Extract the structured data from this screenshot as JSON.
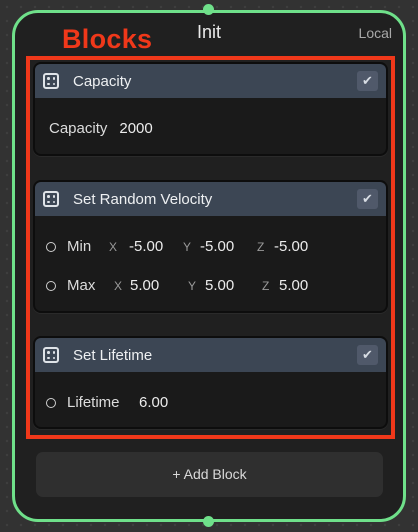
{
  "context": {
    "title": "Init",
    "space": "Local"
  },
  "annotation": {
    "label": "Blocks",
    "color": "#f0381a"
  },
  "accent_color": "#6fe08a",
  "blocks": [
    {
      "title": "Capacity",
      "enabled": true,
      "fields": [
        {
          "label": "Capacity",
          "value": "2000"
        }
      ]
    },
    {
      "title": "Set Random Velocity",
      "enabled": true,
      "fields": [
        {
          "label": "Min",
          "x_axis": "X",
          "x": "-5.00",
          "y_axis": "Y",
          "y": "-5.00",
          "z_axis": "Z",
          "z": "-5.00"
        },
        {
          "label": "Max",
          "x_axis": "X",
          "x": "5.00",
          "y_axis": "Y",
          "y": "5.00",
          "z_axis": "Z",
          "z": "5.00"
        }
      ]
    },
    {
      "title": "Set Lifetime",
      "enabled": true,
      "fields": [
        {
          "label": "Lifetime",
          "value": "6.00"
        }
      ]
    }
  ],
  "add_block_label": "+ Add Block",
  "icons": {
    "block": "block-dots-icon",
    "toggle": "checkmark-icon",
    "port": "flow-port-icon",
    "field_link": "circle-port-icon"
  }
}
